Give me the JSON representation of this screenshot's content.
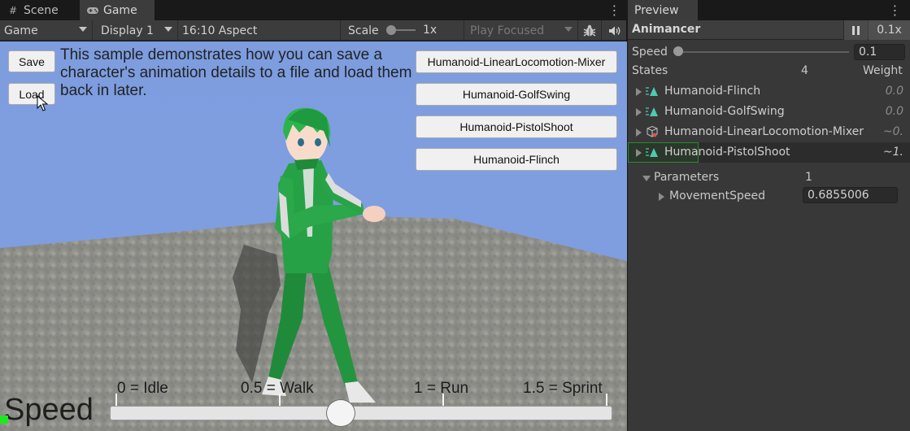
{
  "tabs_left": [
    {
      "label": "Scene",
      "icon": "hash-icon"
    },
    {
      "label": "Game",
      "icon": "gamepad-icon"
    }
  ],
  "tab_right": {
    "label": "Preview"
  },
  "toolbar": {
    "display_mode": "Game",
    "display": "Display 1",
    "aspect": "16:10 Aspect",
    "scale_label": "Scale",
    "scale_value": "1x",
    "play_focused": "Play Focused"
  },
  "game": {
    "save_button": "Save",
    "load_button": "Load",
    "description": "This sample demonstrates how you can save a character's animation details to a file and load them back in later.",
    "anim_buttons": [
      "Humanoid-LinearLocomotion-Mixer",
      "Humanoid-GolfSwing",
      "Humanoid-PistolShoot",
      "Humanoid-Flinch"
    ],
    "speed_label": "Speed",
    "speed_ticks": [
      "0 = Idle",
      "0.5 = Walk",
      "1 = Run",
      "1.5 = Sprint"
    ],
    "speed_value_fraction": 0.46
  },
  "panel": {
    "title": "Animancer",
    "rate": "0.1x",
    "speed_label": "Speed",
    "speed_value": "0.1",
    "states_label": "States",
    "states_count": "4",
    "weight_label": "Weight",
    "states": [
      {
        "name": "Humanoid-Flinch",
        "weight": "0.0",
        "icon": "clip-icon"
      },
      {
        "name": "Humanoid-GolfSwing",
        "weight": "0.0",
        "icon": "clip-icon"
      },
      {
        "name": "Humanoid-LinearLocomotion-Mixer",
        "weight": "~0.",
        "icon": "mixer-icon"
      },
      {
        "name": "Humanoid-PistolShoot",
        "weight": "~1.",
        "icon": "clip-icon"
      }
    ],
    "parameters_label": "Parameters",
    "parameters_count": "1",
    "param_name": "MovementSpeed",
    "param_value": "0.6855006"
  },
  "colors": {
    "sky": "#7d9ddf",
    "clip_icon": "#4fc9b0",
    "selection_outline": "#2a8a2a"
  }
}
